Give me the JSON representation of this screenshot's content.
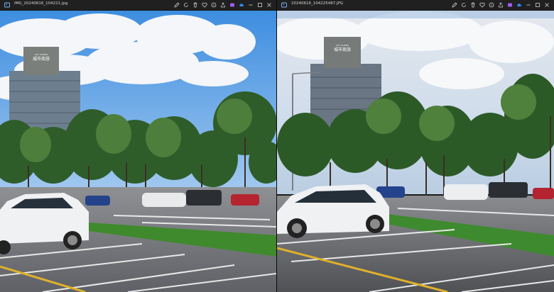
{
  "left_viewer": {
    "filename": "IMG_20240616_104221.jpg",
    "building_sign": "城市商旅",
    "building_sign_sub": "CITY SUITES"
  },
  "right_viewer": {
    "filename": "20240616_104225487.JPG",
    "building_sign": "城市商旅",
    "building_sign_sub": "CITY SUITES"
  },
  "toolbar_icons": [
    "crop-icon",
    "rotate-icon",
    "trash-icon",
    "heart-icon",
    "info-icon",
    "share-icon",
    "adjust-icon",
    "copilot-icon",
    "cloud-icon",
    "more-icon",
    "minimize-icon",
    "maximize-icon",
    "close-icon"
  ],
  "colors": {
    "titlebar": "#202020",
    "title_text": "#d8d8d8",
    "icon": "#cfcfcf",
    "copilot": "#a45cf5",
    "cloud": "#2f8cf5"
  }
}
